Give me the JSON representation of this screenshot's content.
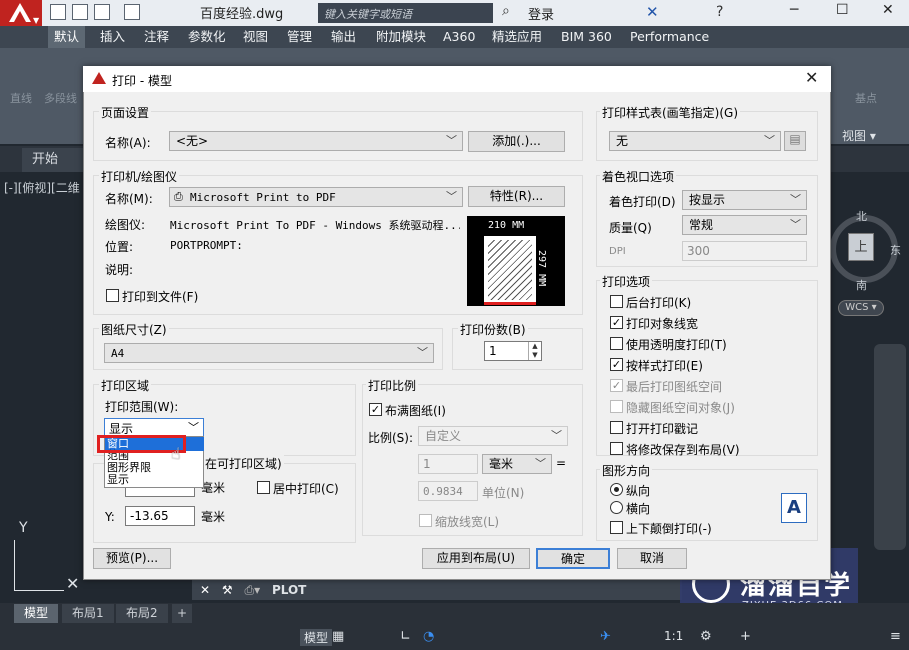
{
  "app": {
    "doc_title": "百度经验.dwg",
    "search_placeholder": "键入关键字或短语",
    "login": "登录"
  },
  "ribbon": {
    "tabs": [
      "默认",
      "插入",
      "注释",
      "参数化",
      "视图",
      "管理",
      "输出",
      "附加模块",
      "A360",
      "精选应用",
      "BIM 360",
      "Performance"
    ],
    "panel_labels": [
      "直线",
      "多段线"
    ],
    "right_label": "基点",
    "view_label": "视图 ▾"
  },
  "workspace": {
    "start_tab": "开始",
    "view_label": "[-][俯视][二维",
    "viewcube": {
      "north": "北",
      "south": "南",
      "east": "东",
      "face": "上"
    },
    "wcs": "WCS ▾",
    "y_axis": "Y"
  },
  "cmdline": {
    "text": "PLOT"
  },
  "layout_tabs": [
    "模型",
    "布局1",
    "布局2",
    "+"
  ],
  "status": {
    "model": "模型",
    "scale": "1:1"
  },
  "watermark": {
    "title": "溜溜自学",
    "subtitle": "ZIXUE.3D66.COM"
  },
  "dialog": {
    "title": "打印 - 模型",
    "page_setup": {
      "group": "页面设置",
      "name_label": "名称(A):",
      "name_value": "<无>",
      "add_button": "添加(.)..."
    },
    "printer": {
      "group": "打印机/绘图仪",
      "name_label": "名称(M):",
      "name_value": "Microsoft Print to PDF",
      "properties_button": "特性(R)...",
      "plotter_label": "绘图仪:",
      "plotter_value": "Microsoft Print To PDF - Windows 系统驱动程...",
      "location_label": "位置:",
      "location_value": "PORTPROMPT:",
      "desc_label": "说明:",
      "print_to_file": "打印到文件(F)",
      "preview_width": "210 MM",
      "preview_height": "297 MM"
    },
    "paper_size": {
      "group": "图纸尺寸(Z)",
      "value": "A4"
    },
    "copies": {
      "group": "打印份数(B)",
      "value": "1"
    },
    "plot_area": {
      "group": "打印区域",
      "range_label": "打印范围(W):",
      "range_value": "显示",
      "options": [
        "窗口",
        "范围",
        "图形界限",
        "显示"
      ]
    },
    "offset": {
      "group_suffix": "在可打印区域)",
      "x_unit": "毫米",
      "center": "居中打印(C)",
      "y_label": "Y:",
      "y_value": "-13.65",
      "y_unit": "毫米"
    },
    "scale": {
      "group": "打印比例",
      "fit": "布满图纸(I)",
      "scale_label": "比例(S):",
      "scale_value": "自定义",
      "v1": "1",
      "unit": "毫米",
      "eq": "=",
      "v2": "0.9834",
      "unit2": "单位(N)",
      "lineweight": "缩放线宽(L)"
    },
    "style_table": {
      "group": "打印样式表(画笔指定)(G)",
      "value": "无"
    },
    "shaded": {
      "group": "着色视口选项",
      "shade_label": "着色打印(D)",
      "shade_value": "按显示",
      "quality_label": "质量(Q)",
      "quality_value": "常规",
      "dpi_label": "DPI",
      "dpi_value": "300"
    },
    "options": {
      "group": "打印选项",
      "items": [
        {
          "label": "后台打印(K)",
          "checked": false,
          "disabled": false
        },
        {
          "label": "打印对象线宽",
          "checked": true,
          "disabled": false
        },
        {
          "label": "使用透明度打印(T)",
          "checked": false,
          "disabled": false
        },
        {
          "label": "按样式打印(E)",
          "checked": true,
          "disabled": false
        },
        {
          "label": "最后打印图纸空间",
          "checked": true,
          "disabled": true
        },
        {
          "label": "隐藏图纸空间对象(J)",
          "checked": false,
          "disabled": true
        },
        {
          "label": "打开打印戳记",
          "checked": false,
          "disabled": false
        },
        {
          "label": "将修改保存到布局(V)",
          "checked": false,
          "disabled": false
        }
      ]
    },
    "orientation": {
      "group": "图形方向",
      "portrait": "纵向",
      "landscape": "横向",
      "upside": "上下颠倒打印(-)",
      "icon_letter": "A"
    },
    "buttons": {
      "preview": "预览(P)...",
      "apply": "应用到布局(U)",
      "ok": "确定",
      "cancel": "取消"
    }
  }
}
